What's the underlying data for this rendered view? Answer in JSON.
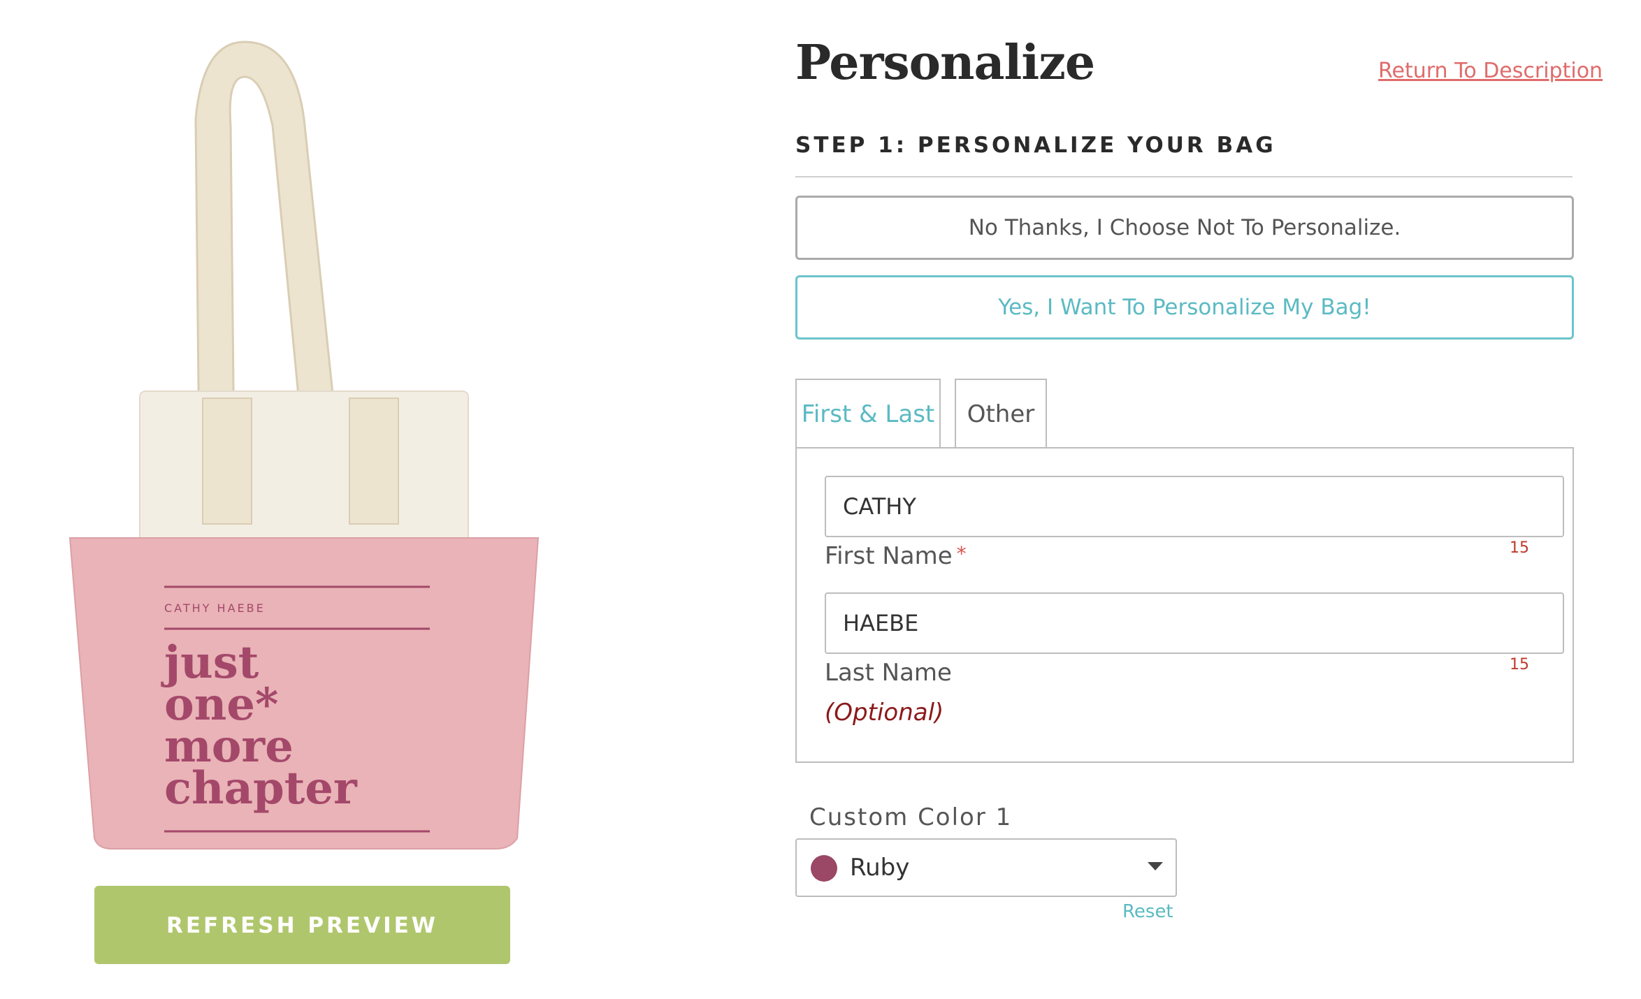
{
  "preview": {
    "bag": {
      "name_line": "CATHY HAEBE",
      "headline_lines": [
        "just",
        "one*",
        "more",
        "chapter"
      ],
      "colors": {
        "body": "#e9b3b7",
        "top": "#f3eee4",
        "straps": "#ede4d0",
        "accent": "#a4486a"
      }
    },
    "refresh_button": "REFRESH PREVIEW"
  },
  "page_title": "Personalize",
  "return_link": "Return To Description",
  "step1": {
    "heading": "STEP 1: PERSONALIZE YOUR BAG",
    "option_no": "No Thanks, I Choose Not To Personalize.",
    "option_yes": "Yes, I Want To Personalize My Bag!"
  },
  "tabs": [
    {
      "label": "First & Last",
      "active": true
    },
    {
      "label": "Other",
      "active": false
    }
  ],
  "fields": {
    "first_name": {
      "value": "CATHY",
      "label": "First Name",
      "required_mark": "*",
      "max": "15"
    },
    "last_name": {
      "value": "HAEBE",
      "label": "Last Name",
      "max": "15",
      "note": "(Optional)"
    }
  },
  "custom_color": {
    "label": "Custom Color 1",
    "selected": "Ruby",
    "swatch": "#9b4766",
    "reset": "Reset"
  },
  "colors": {
    "teal": "#5bbac3",
    "coral": "#e06b6b",
    "green": "#b0c66d"
  }
}
